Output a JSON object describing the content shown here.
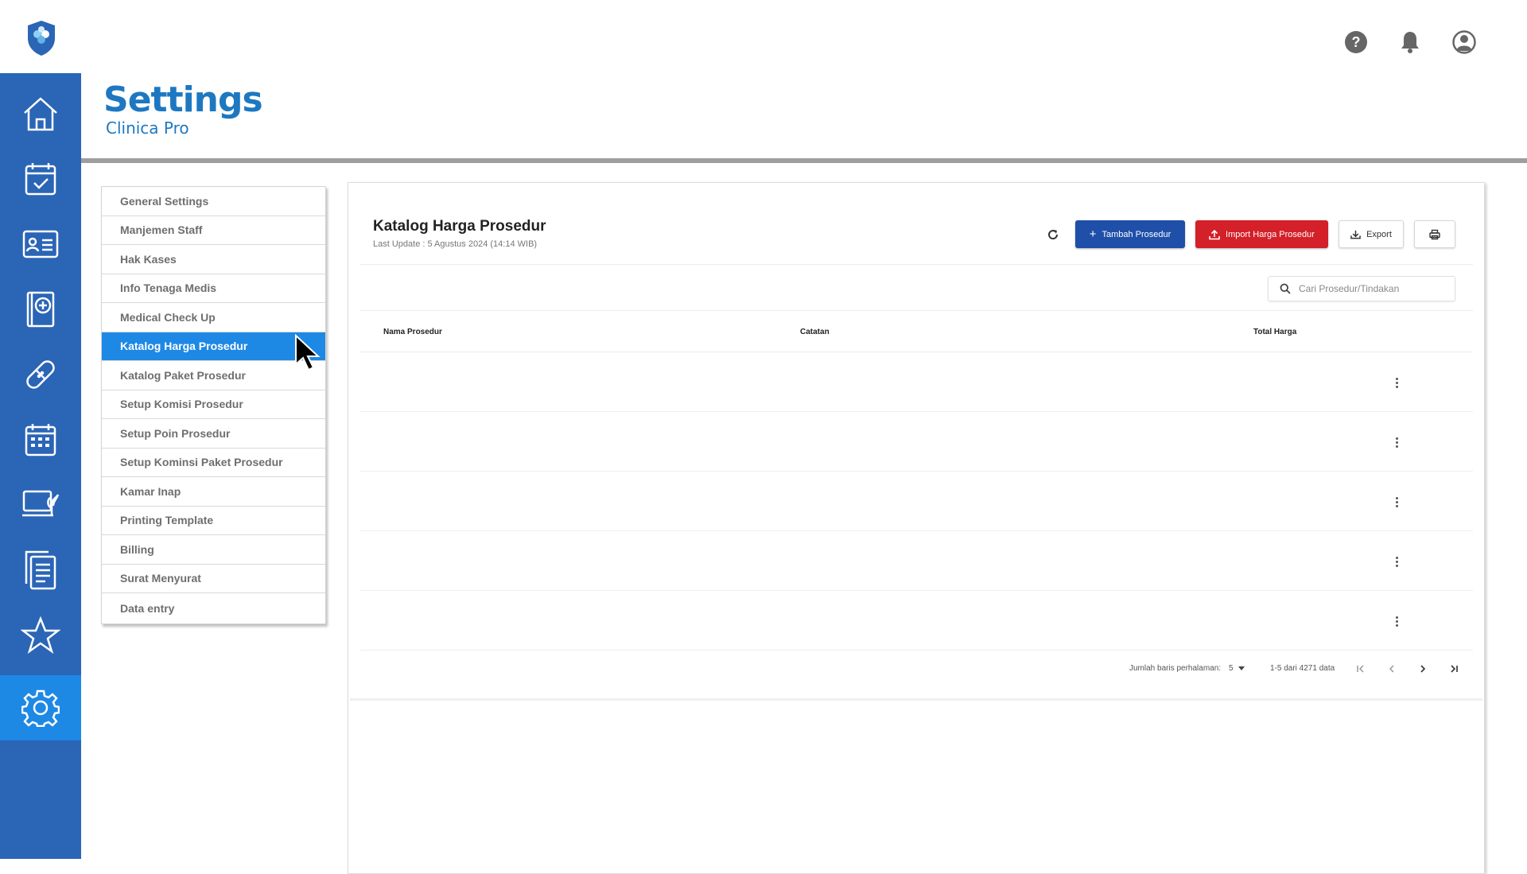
{
  "header": {
    "title": "Settings",
    "subtitle": "Clinica Pro"
  },
  "top_icons": [
    "help-icon",
    "bell-icon",
    "user-icon"
  ],
  "sidebar": {
    "items": [
      "home-icon",
      "calendar-check-icon",
      "id-card-icon",
      "medical-book-icon",
      "bandage-icon",
      "calendar-grid-icon",
      "monitor-plant-icon",
      "clipboard-list-icon",
      "star-icon",
      "gear-icon"
    ],
    "active": "gear-icon"
  },
  "menu": {
    "items": [
      {
        "label": "General Settings"
      },
      {
        "label": "Manjemen Staff"
      },
      {
        "label": "Hak Kases"
      },
      {
        "label": "Info Tenaga Medis"
      },
      {
        "label": "Medical Check Up"
      },
      {
        "label": "Katalog Harga Prosedur",
        "active": true
      },
      {
        "label": "Katalog Paket Prosedur"
      },
      {
        "label": "Setup Komisi Prosedur"
      },
      {
        "label": "Setup Poin Prosedur"
      },
      {
        "label": "Setup Kominsi Paket Prosedur"
      },
      {
        "label": "Kamar Inap"
      },
      {
        "label": "Printing Template"
      },
      {
        "label": "Billing"
      },
      {
        "label": "Surat Menyurat"
      },
      {
        "label": "Data entry"
      }
    ]
  },
  "panel": {
    "title": "Katalog Harga Prosedur",
    "last_update": "Last Update : 5 Agustus 2024 (14:14 WIB)",
    "buttons": {
      "add": "Tambah Prosedur",
      "import": "Import Harga Prosedur",
      "export": "Export"
    },
    "search_placeholder": "Cari Prosedur/Tindakan",
    "table": {
      "headers": [
        "Nama Prosedur",
        "Catatan",
        "Total Harga"
      ],
      "rows": 5
    },
    "pagination": {
      "rows_label": "Jumlah baris perhalaman:",
      "rows_value": "5",
      "range": "1-5 dari 4271 data"
    }
  },
  "colors": {
    "sidebar": "#2b65b6",
    "active": "#1e88e5",
    "primary": "#1f4fa8",
    "danger": "#d32029",
    "title": "#1d78c1"
  }
}
